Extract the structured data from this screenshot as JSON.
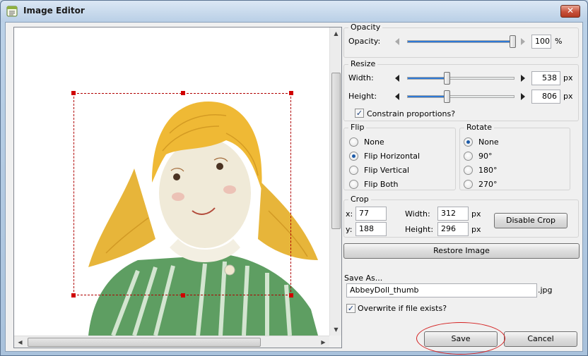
{
  "window": {
    "title": "Image Editor",
    "close_glyph": "✕"
  },
  "opacity": {
    "legend": "Opacity",
    "label": "Opacity:",
    "value": "100",
    "unit": "%",
    "level_percent": 100
  },
  "resize": {
    "legend": "Resize",
    "width_label": "Width:",
    "width_value": "538",
    "width_unit": "px",
    "height_label": "Height:",
    "height_value": "806",
    "height_unit": "px",
    "constrain_label": "Constrain proportions?",
    "constrain_checked": true
  },
  "flip": {
    "legend": "Flip",
    "options": [
      "None",
      "Flip Horizontal",
      "Flip Vertical",
      "Flip Both"
    ],
    "selected": "Flip Horizontal"
  },
  "rotate": {
    "legend": "Rotate",
    "options": [
      "None",
      "90°",
      "180°",
      "270°"
    ],
    "selected": "None"
  },
  "crop": {
    "legend": "Crop",
    "x_label": "x:",
    "x_value": "77",
    "y_label": "y:",
    "y_value": "188",
    "width_label": "Width:",
    "width_value": "312",
    "height_label": "Height:",
    "height_value": "296",
    "unit": "px",
    "disable_button": "Disable Crop"
  },
  "restore_button": "Restore Image",
  "save_as": {
    "label": "Save As...",
    "filename": "AbbeyDoll_thumb",
    "extension": ".jpg",
    "overwrite_label": "Overwrite if file exists?",
    "overwrite_checked": true
  },
  "buttons": {
    "save": "Save",
    "cancel": "Cancel"
  },
  "icons": {
    "scroll_up": "▲",
    "scroll_down": "▼",
    "scroll_left": "◀",
    "scroll_right": "▶",
    "check": "✓"
  },
  "colors": {
    "crop_border": "#b00000",
    "slider_fill": "#2e79d6",
    "save_highlight": "#d42020"
  }
}
